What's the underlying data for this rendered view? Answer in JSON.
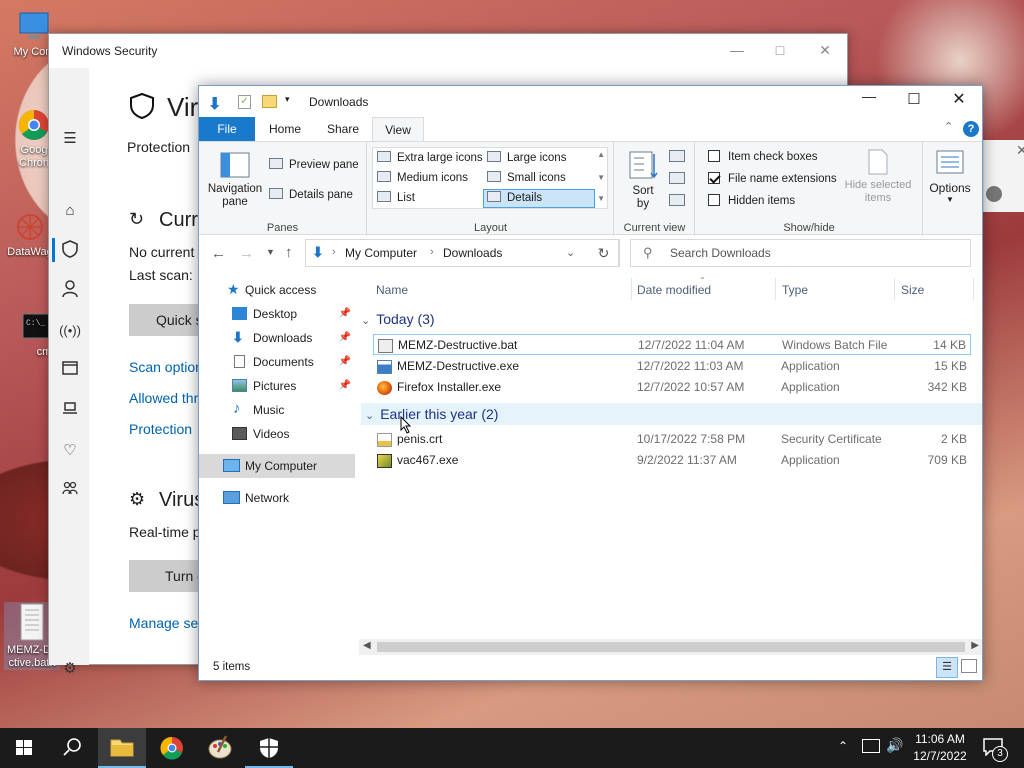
{
  "desktop": {
    "icons": [
      {
        "label": "My Com"
      },
      {
        "label": "Goog Chron"
      },
      {
        "label": "DataWag"
      },
      {
        "label": "cmd"
      },
      {
        "label": "MEMZ-De ctive.bat.t"
      }
    ]
  },
  "windows_security": {
    "title": "Windows Security",
    "heading": "Vir",
    "subtitle": "Protection",
    "current_heading": "Curr",
    "no_current": "No current",
    "last_scan": "Last scan: ",
    "quick_scan_btn": "Quick s",
    "links": [
      "Scan option",
      "Allowed thr",
      "Protection ",
      "Manage set"
    ],
    "virus_heading": "Virus",
    "realtime": "Real-time p",
    "turn_btn": "Turn o"
  },
  "explorer": {
    "title": "Downloads",
    "tabs": [
      "File",
      "Home",
      "Share",
      "View"
    ],
    "active_tab": "View",
    "ribbon": {
      "panes": {
        "navigation_pane": "Navigation pane",
        "preview_pane": "Preview pane",
        "details_pane": "Details pane",
        "group": "Panes"
      },
      "layout": {
        "items": [
          "Extra large icons",
          "Large icons",
          "Medium icons",
          "Small icons",
          "List",
          "Details"
        ],
        "selected": "Details",
        "group": "Layout"
      },
      "current_view": {
        "sort_by": "Sort by",
        "group": "Current view"
      },
      "show_hide": {
        "item_check_boxes": {
          "label": "Item check boxes",
          "checked": false
        },
        "file_name_extensions": {
          "label": "File name extensions",
          "checked": true
        },
        "hidden_items": {
          "label": "Hidden items",
          "checked": false
        },
        "hide_selected": "Hide selected items",
        "group": "Show/hide"
      },
      "options": "Options"
    },
    "address": {
      "crumbs": [
        "My Computer",
        "Downloads"
      ],
      "search_placeholder": "Search Downloads"
    },
    "nav_pane": {
      "quick_access": "Quick access",
      "items": [
        {
          "label": "Desktop",
          "pinned": true
        },
        {
          "label": "Downloads",
          "pinned": true
        },
        {
          "label": "Documents",
          "pinned": true
        },
        {
          "label": "Pictures",
          "pinned": true
        },
        {
          "label": "Music",
          "pinned": false
        },
        {
          "label": "Videos",
          "pinned": false
        }
      ],
      "my_computer": "My Computer",
      "network": "Network"
    },
    "columns": [
      "Name",
      "Date modified",
      "Type",
      "Size"
    ],
    "groups": [
      {
        "label": "Today (3)",
        "files": [
          {
            "name": "MEMZ-Destructive.bat",
            "date": "12/7/2022 11:04 AM",
            "type": "Windows Batch File",
            "size": "14 KB"
          },
          {
            "name": "MEMZ-Destructive.exe",
            "date": "12/7/2022 11:03 AM",
            "type": "Application",
            "size": "15 KB"
          },
          {
            "name": "Firefox Installer.exe",
            "date": "12/7/2022 10:57 AM",
            "type": "Application",
            "size": "342 KB"
          }
        ]
      },
      {
        "label": "Earlier this year (2)",
        "files": [
          {
            "name": "penis.crt",
            "date": "10/17/2022 7:58 PM",
            "type": "Security Certificate",
            "size": "2 KB"
          },
          {
            "name": "vac467.exe",
            "date": "9/2/2022 11:37 AM",
            "type": "Application",
            "size": "709 KB"
          }
        ]
      }
    ],
    "status": "5 items"
  },
  "taskbar": {
    "time": "11:06 AM",
    "date": "12/7/2022",
    "notification_count": "3"
  },
  "colors": {
    "accent": "#0078d7",
    "ribbon_file_tab": "#1979ca",
    "taskbar": "#1b1b1b"
  }
}
